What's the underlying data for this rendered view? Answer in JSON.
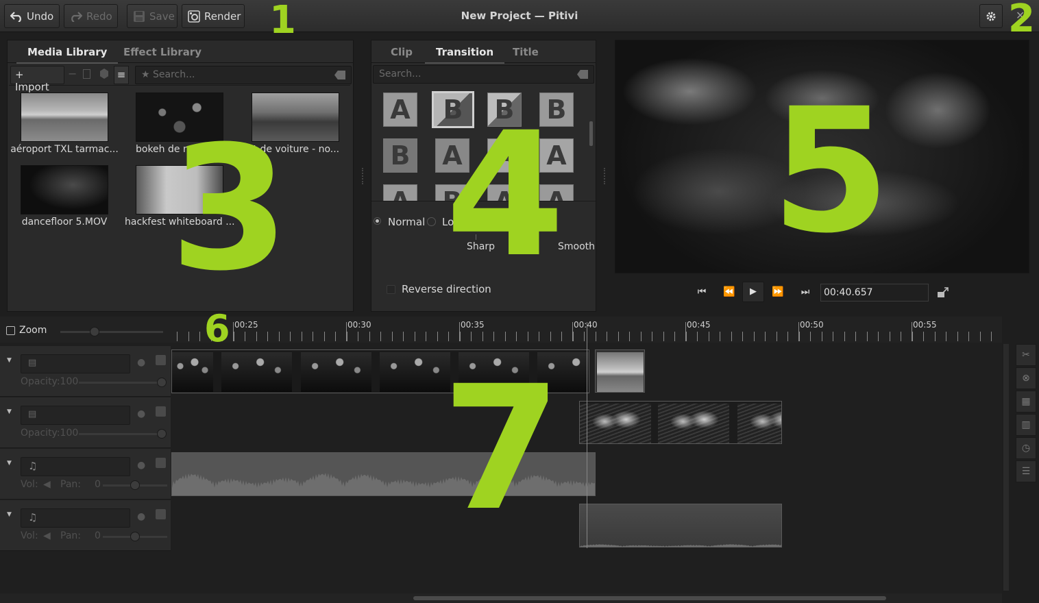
{
  "window": {
    "title": "New Project — Pitivi"
  },
  "toolbar": {
    "undo_label": "Undo",
    "redo_label": "Redo",
    "save_label": "Save",
    "render_label": "Render"
  },
  "annotations": [
    "1",
    "2",
    "3",
    "4",
    "5",
    "6",
    "7"
  ],
  "media_panel": {
    "tabs": [
      "Media Library",
      "Effect Library"
    ],
    "import_label": "Import",
    "search_placeholder": "Search...",
    "items": [
      "aéroport TXL tarmac...",
      "bokeh de nu",
      "ot de voiture - no...",
      "dancefloor 5.MOV",
      "hackfest whiteboard ..."
    ]
  },
  "transition_panel": {
    "tabs": [
      "Clip",
      "Transition",
      "Title"
    ],
    "search_placeholder": "Search...",
    "mode_normal": "Normal",
    "mode_loop": "Lo",
    "sharp_label": "Sharp",
    "smooth_label": "Smooth",
    "reverse_label": "Reverse direction"
  },
  "viewer": {
    "timecode": "00:40.657"
  },
  "timeline": {
    "zoom_label": "Zoom",
    "ruler_labels": [
      "00:25",
      "00:30",
      "00:35",
      "00:40",
      "00:45",
      "00:50",
      "00:55"
    ],
    "layers": [
      {
        "sub": "Opacity:100"
      },
      {
        "sub": "Opacity:100"
      },
      {
        "vol": "Vol:",
        "pan": "Pan:",
        "pan_value": "0"
      },
      {
        "vol": "Vol:",
        "pan": "Pan:",
        "pan_value": "0"
      }
    ]
  }
}
